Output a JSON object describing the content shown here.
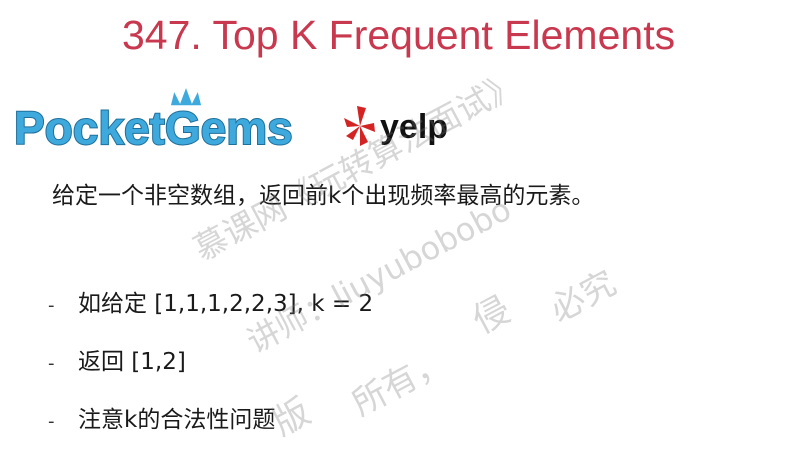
{
  "title": "347. Top K Frequent Elements",
  "logos": {
    "pocket_gems": "PocketGems",
    "yelp": "yelp"
  },
  "description": "给定一个非空数组，返回前k个出现频率最高的元素。",
  "bullets": [
    {
      "dash": "-",
      "text": "如给定 [1,1,1,2,2,3], k = 2"
    },
    {
      "dash": "-",
      "text": "返回 [1,2]"
    },
    {
      "dash": "-",
      "text": "注意k的合法性问题"
    }
  ],
  "watermark": {
    "line1": "慕课网《玩转算法面试》",
    "line2": "讲师：liuyubobobo",
    "line3": "必究",
    "line4": "侵",
    "line5": "所有，",
    "line6": "版"
  },
  "colors": {
    "title": "#c8384e",
    "pocket_gems": "#3ea9dd",
    "yelp_burst": "#d32323"
  }
}
